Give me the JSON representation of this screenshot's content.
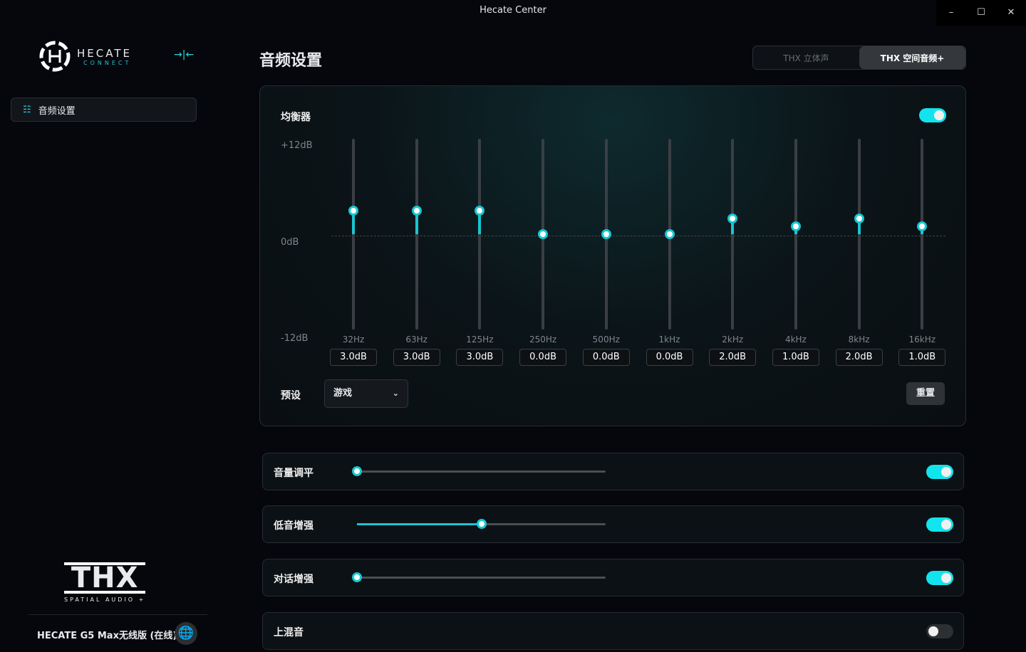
{
  "window": {
    "title": "Hecate Center",
    "minimize": "–",
    "maximize": "☐",
    "close": "✕"
  },
  "logo": {
    "name": "HECATE",
    "sub": "CONNECT"
  },
  "sidebar": {
    "items": [
      {
        "label": "音频设置"
      }
    ],
    "device": "HECATE G5 Max无线版 (在线)",
    "thx_logo": "THX",
    "thx_sub": "SPATIAL AUDIO +"
  },
  "page": {
    "title": "音频设置"
  },
  "modes": [
    {
      "label": "THX 立体声",
      "active": false
    },
    {
      "label": "THX 空间音频+",
      "active": true
    }
  ],
  "equalizer": {
    "label": "均衡器",
    "enabled": true,
    "scale": [
      "+12dB",
      "0dB",
      "-12dB"
    ],
    "bands": [
      {
        "freq": "32Hz",
        "db": 3.0,
        "label": "3.0dB"
      },
      {
        "freq": "63Hz",
        "db": 3.0,
        "label": "3.0dB"
      },
      {
        "freq": "125Hz",
        "db": 3.0,
        "label": "3.0dB"
      },
      {
        "freq": "250Hz",
        "db": 0,
        "label": "0.0dB"
      },
      {
        "freq": "500Hz",
        "db": 0,
        "label": "0.0dB"
      },
      {
        "freq": "1kHz",
        "db": 0,
        "label": "0.0dB"
      },
      {
        "freq": "2kHz",
        "db": 2.0,
        "label": "2.0dB"
      },
      {
        "freq": "4kHz",
        "db": 1.0,
        "label": "1.0dB"
      },
      {
        "freq": "8kHz",
        "db": 2.0,
        "label": "2.0dB"
      },
      {
        "freq": "16kHz",
        "db": 1.0,
        "label": "1.0dB"
      }
    ],
    "preset_label": "预设",
    "preset_value": "游戏",
    "reset": "重置"
  },
  "features": [
    {
      "label": "音量调平",
      "enabled": true,
      "level": 0
    },
    {
      "label": "低音增强",
      "enabled": true,
      "level": 50
    },
    {
      "label": "对话增强",
      "enabled": true,
      "level": 0
    },
    {
      "label": "上混音",
      "enabled": false
    }
  ],
  "colors": {
    "accent": "#12e4ee"
  }
}
